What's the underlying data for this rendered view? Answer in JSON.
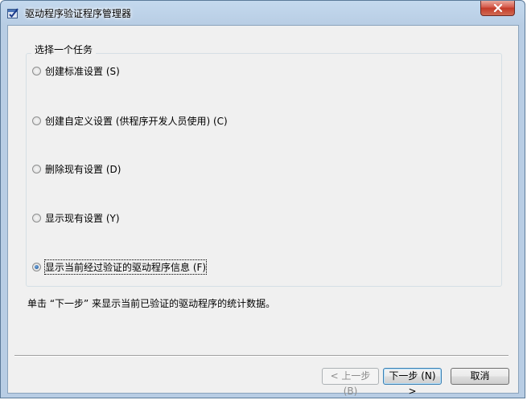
{
  "window": {
    "title": "驱动程序验证程序管理器",
    "icon": "checkmark-window-icon"
  },
  "group": {
    "legend": "选择一个任务",
    "options": [
      {
        "label": "创建标准设置 (S)",
        "checked": false
      },
      {
        "label": "创建自定义设置 (供程序开发人员使用) (C)",
        "checked": false
      },
      {
        "label": "删除现有设置 (D)",
        "checked": false
      },
      {
        "label": "显示现有设置 (Y)",
        "checked": false
      },
      {
        "label": "显示当前经过验证的驱动程序信息 (F)",
        "checked": true
      }
    ]
  },
  "description": "单击 “下一步” 来显示当前已验证的驱动程序的统计数据。",
  "buttons": {
    "back": "< 上一步 (B)",
    "next": "下一步 (N) >",
    "cancel": "取消"
  }
}
